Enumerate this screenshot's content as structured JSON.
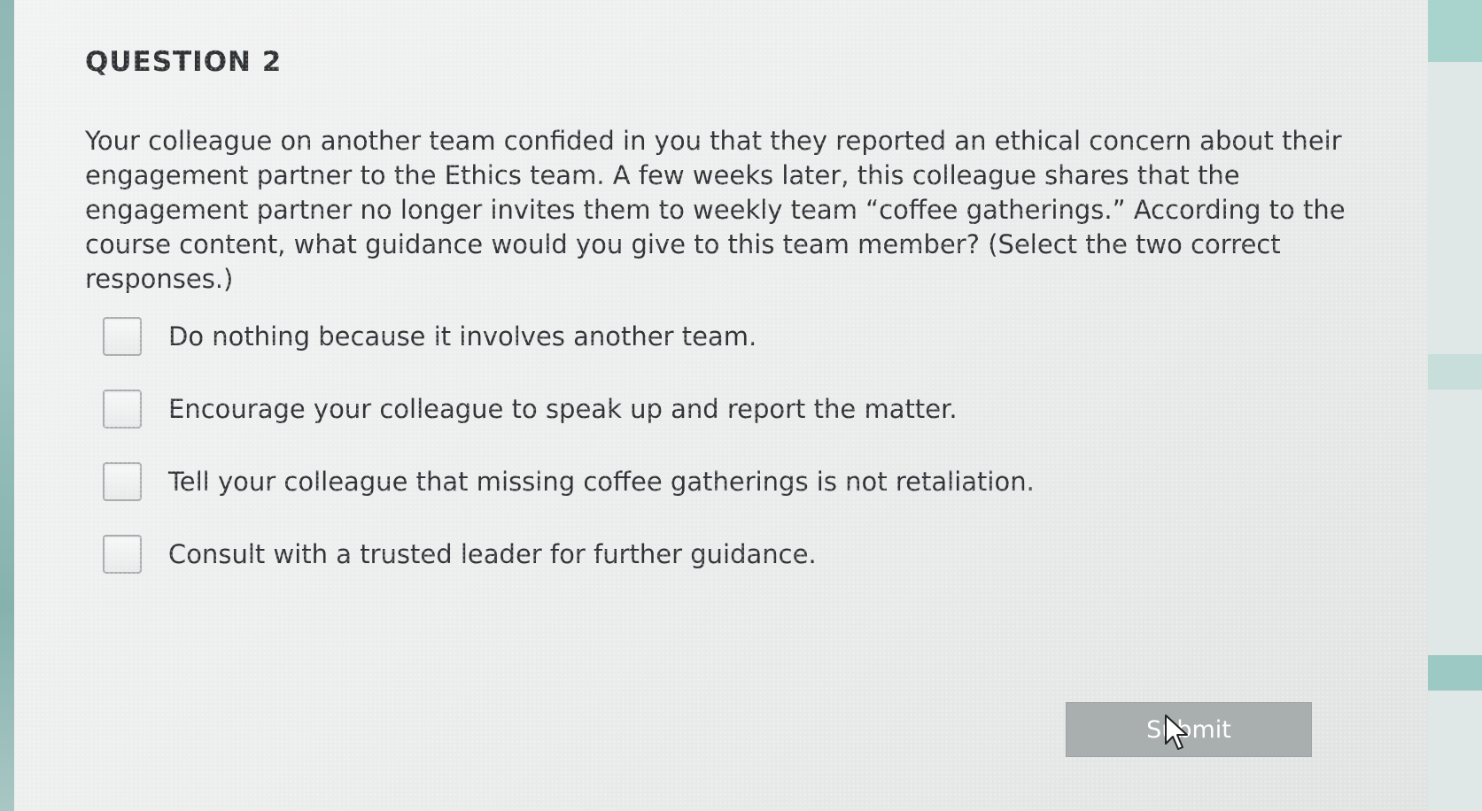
{
  "question": {
    "title": "QUESTION 2",
    "text": "Your colleague on another team confided in you that they reported an ethical concern about their engagement partner to the Ethics team. A few weeks later, this colleague shares that the engagement partner no longer invites them to weekly team “coffee gatherings.” According to the course content, what guidance would you give to this team member? (Select the two correct responses.)"
  },
  "options": [
    {
      "label": "Do nothing because it involves another team.",
      "checked": false
    },
    {
      "label": "Encourage your colleague to speak up and report the matter.",
      "checked": false
    },
    {
      "label": "Tell your colleague that missing coffee gatherings is not retaliation.",
      "checked": false
    },
    {
      "label": "Consult with a trusted leader for further guidance.",
      "checked": false
    }
  ],
  "submit": {
    "label": "Submit"
  },
  "icons": {
    "cursor": "mouse-pointer-icon"
  },
  "colors": {
    "card_background": "#eceded",
    "text": "#303336",
    "submit_background": "#a9aeae",
    "submit_text": "#ffffff",
    "checkbox_border": "#a8adb0"
  }
}
